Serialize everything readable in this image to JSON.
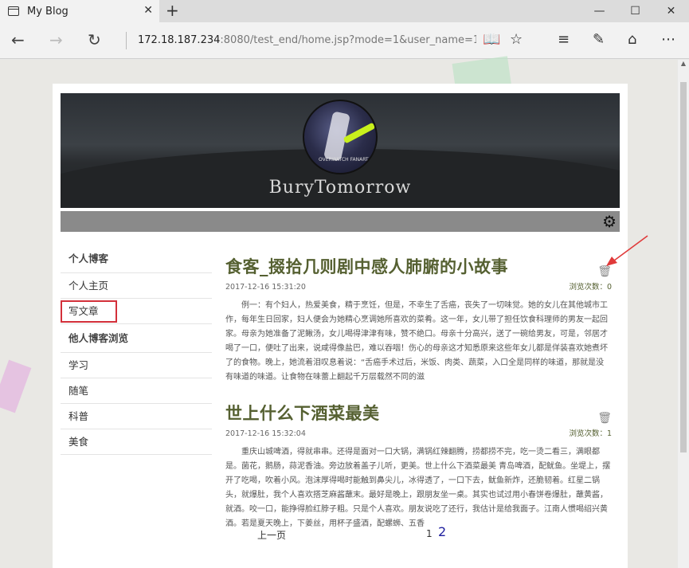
{
  "browser": {
    "tab_title": "My Blog",
    "tab_close": "✕",
    "new_tab": "+",
    "window_controls": [
      "—",
      "☐",
      "✕"
    ],
    "back": "←",
    "forward": "→",
    "refresh": "↻",
    "address_host": "172.18.187.234",
    "address_path": ":8080/test_end/home.jsp?mode=1&user_name=153520138",
    "tools": [
      "📖",
      "☆",
      "≡",
      "✎",
      "⌂",
      "⋯"
    ]
  },
  "banner": {
    "avatar_caption": "OVERWATCH FANART",
    "blog_name": "BuryTomorrow"
  },
  "settings_icon": "⚙",
  "sidebar": {
    "personal_header": "个人博客",
    "home": "个人主页",
    "write": "写文章",
    "browse_header": "他人博客浏览",
    "categories": [
      "学习",
      "随笔",
      "科普",
      "美食"
    ]
  },
  "articles": [
    {
      "title": "食客_掇拾几则剧中感人肺腑的小故事",
      "date": "2017-12-16 15:31:20",
      "views": "浏览次数：0",
      "body": "例一：有个妇人，热爱美食，精于烹饪，但是，不幸生了舌癌，丧失了一切味觉。她的女儿在其他城市工作，每年生日回家，妇人便会为她精心烹调她所喜欢的菜肴。这一年，女儿带了担任饮食科理师的男友一起回家。母亲为她准备了泥鳅汤，女儿喝得津津有味，赞不绝口。母亲十分高兴，送了一碗给男友，可是，邻居才喝了一口，便吐了出来，说咸得像盐巴，难以吞咽！伤心的母亲这才知悉原来这些年女儿都是佯装喜欢她煮坏了的食物。晚上，她流着泪叹息着说：“舌癌手术过后，米饭、肉类、蔬菜，入口全是同样的味道，那就是没有味道的味道。让食物在味蕾上翻起千万层载然不同的滋"
    },
    {
      "title": "世上什么下酒菜最美",
      "date": "2017-12-16 15:32:04",
      "views": "浏览次数：1",
      "body": "重庆山城啤酒，得就串串。还得是面对一口大锅，满锅红辣翻腾，捞都捞不完，吃一烫二看三，满眼都是。菌花，鹅肠，蒜泥香油。旁边放着盖子儿听，更美。世上什么下酒菜最美 青岛啤酒，配鱿鱼。坐堤上，摆开了吃喝，吹着小风。泡沫厚得喝时能触到鼻尖儿，冰得透了，一口下去，鱿鱼新炸，还脆韧着。红星二锅头，就爆肚，我个人喜欢搭芝麻酱蘸末。最好是晚上，跟朋友坐一桌。其实也试过用小春饼卷爆肚，蘸黄酱，就酒。咬一口，能挣得脸红脖子粗。只是个人喜欢。朋友说吃了还行，我估计是给我面子。江南人惯喝绍兴黄酒。若是夏天晚上，下姜丝，用杯子盛酒，配螺蛳、五香"
    }
  ],
  "trash_icon": "🗑",
  "pagination": {
    "prev": "上一页",
    "page1": "1",
    "page2": "2"
  },
  "colors": {
    "title_green": "#556031",
    "highlight_red": "#d3303a",
    "arrow_red": "#e03a3a"
  }
}
